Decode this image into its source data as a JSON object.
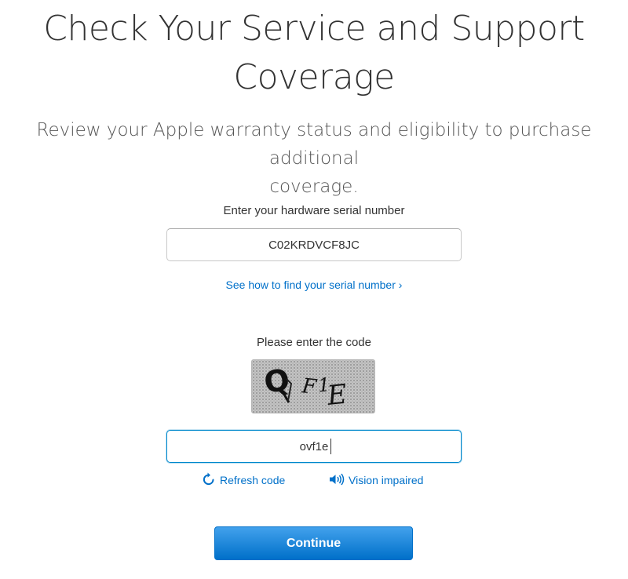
{
  "header": {
    "title_line1": "Check Your Service and Support",
    "title_line2": "Coverage",
    "subtitle_line1": "Review your Apple warranty status and eligibility to purchase additional",
    "subtitle_line2": "coverage."
  },
  "serial": {
    "label": "Enter your hardware serial number",
    "value": "C02KRDVCF8JC",
    "help_link": "See how to find your serial number ›"
  },
  "captcha": {
    "label": "Please enter the code",
    "image_chars": [
      "Q",
      "F",
      "1",
      "E"
    ],
    "input_value": "ovf1e",
    "refresh_label": "Refresh code",
    "refresh_icon": "refresh-icon",
    "vision_label": "Vision impaired",
    "vision_icon": "speaker-icon"
  },
  "actions": {
    "continue_label": "Continue"
  },
  "colors": {
    "link": "#0070c9",
    "button": "#0070c9",
    "focus_border": "#0088cc",
    "text": "#333333"
  }
}
